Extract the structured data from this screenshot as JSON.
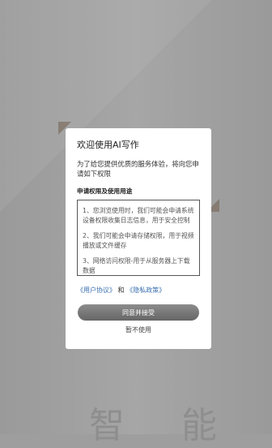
{
  "background": {
    "watermark_text": "智 能"
  },
  "dialog": {
    "title": "欢迎使用AI写作",
    "intro": "为了给您提供优质的服务体验，将向您申请如下权限",
    "section_head": "申请权限及使用用途",
    "permissions": [
      "1、您浏览使用时，我们可能会申请系统设备权限收集日志信息，用于安全控制",
      "2、我们可能会申请存储权限，用于视频播放或文件缓存",
      "3、网络访问权限-用于从服务器上下载数据"
    ],
    "links": {
      "user_agreement": "《用户协议》",
      "and": "和",
      "privacy_policy": "《隐私政策》"
    },
    "accept_label": "同意并接受",
    "decline_label": "暂不使用"
  },
  "colors": {
    "link": "#3a6fb0",
    "button": "#777777",
    "overlay": "#9e9e9e"
  }
}
